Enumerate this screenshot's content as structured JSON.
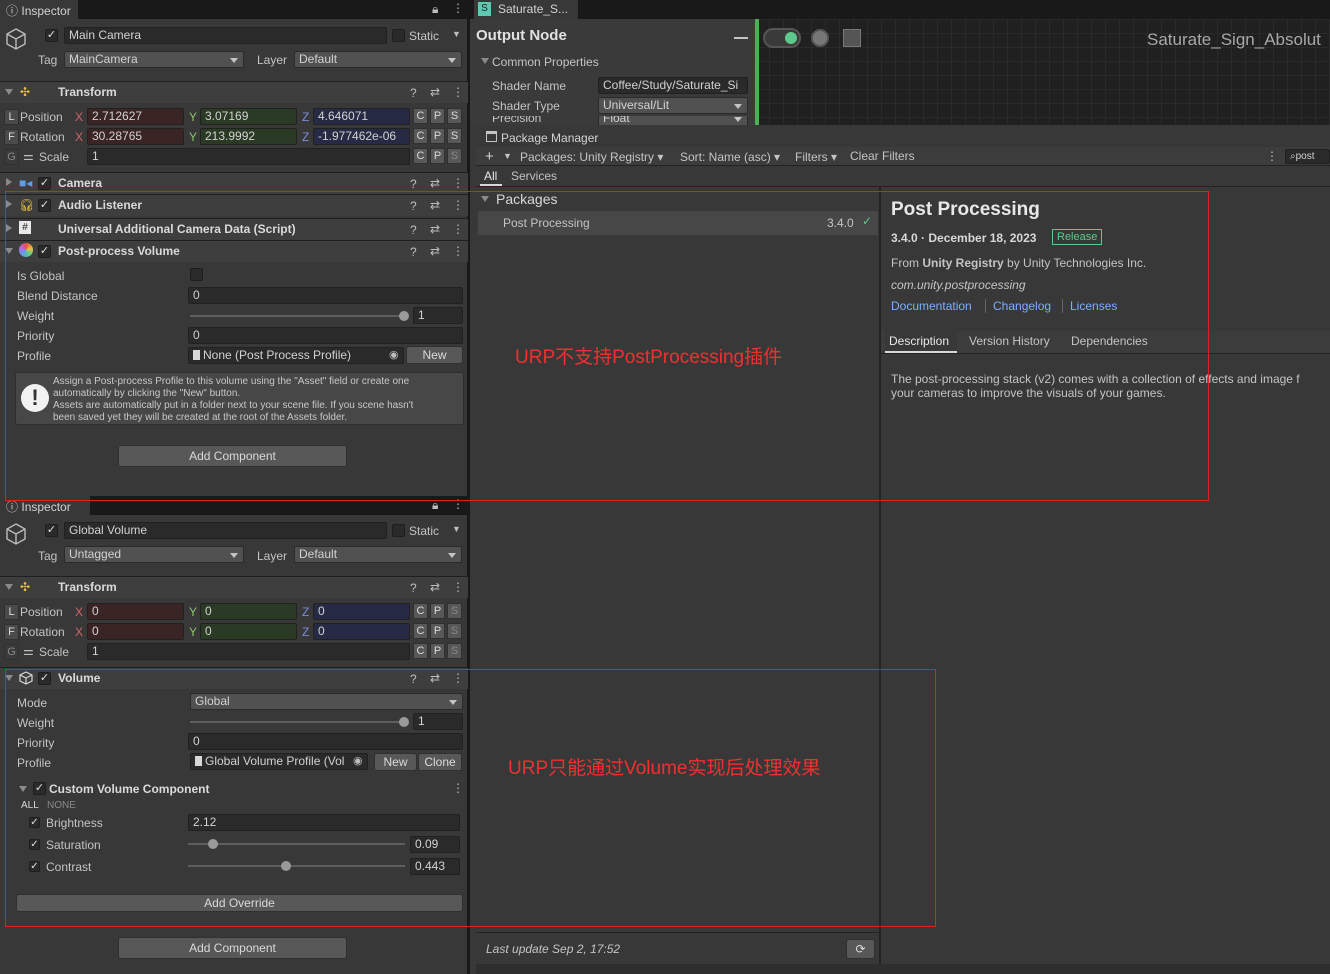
{
  "inspector_top": {
    "tab": "Inspector",
    "object_name": "Main Camera",
    "static_label": "Static",
    "tag_label": "Tag",
    "tag_value": "MainCamera",
    "layer_label": "Layer",
    "layer_value": "Default"
  },
  "transform_top": {
    "title": "Transform",
    "pos_label": "Position",
    "rot_label": "Rotation",
    "scale_label": "Scale",
    "pos": {
      "x": "2.712627",
      "y": "3.07169",
      "z": "4.646071"
    },
    "rot": {
      "x": "30.28765",
      "y": "213.9992",
      "z": "-1.977462e-06"
    },
    "scale": "1",
    "L": "L",
    "F": "F",
    "G": "G"
  },
  "axes": {
    "x": "X",
    "y": "Y",
    "z": "Z",
    "c": "C",
    "p": "P",
    "s": "S"
  },
  "components_top": [
    "Camera",
    "Audio Listener",
    "Universal Additional Camera Data (Script)",
    "Post-process Volume"
  ],
  "ppv": {
    "is_global": "Is Global",
    "blend": "Blend Distance",
    "blend_val": "0",
    "weight": "Weight",
    "weight_val": "1",
    "priority": "Priority",
    "priority_val": "0",
    "profile": "Profile",
    "profile_val": "None (Post Process Profile)",
    "new": "New",
    "help1": "Assign a Post-process Profile to this volume using the \"Asset\" field or create one",
    "help2": "automatically by clicking the \"New\" button.",
    "help3": "Assets are automatically put in a folder next to your scene file. If you scene hasn't",
    "help4": "been saved yet they will be created at the root of the Assets folder.",
    "add_component": "Add Component"
  },
  "inspector_bottom": {
    "tab": "Inspector",
    "object_name": "Global Volume",
    "static_label": "Static",
    "tag_label": "Tag",
    "tag_value": "Untagged",
    "layer_label": "Layer",
    "layer_value": "Default"
  },
  "transform_bottom": {
    "title": "Transform",
    "pos_label": "Position",
    "rot_label": "Rotation",
    "scale_label": "Scale",
    "pos": {
      "x": "0",
      "y": "0",
      "z": "0"
    },
    "rot": {
      "x": "0",
      "y": "0",
      "z": "0"
    },
    "scale": "1"
  },
  "volume": {
    "title": "Volume",
    "mode": "Mode",
    "mode_val": "Global",
    "weight": "Weight",
    "weight_val": "1",
    "priority": "Priority",
    "priority_val": "0",
    "profile": "Profile",
    "profile_val": "Global Volume Profile (Vol",
    "new": "New",
    "clone": "Clone",
    "custom": "Custom Volume Component",
    "all": "ALL",
    "none": "NONE",
    "brightness": "Brightness",
    "brightness_val": "2.12",
    "saturation": "Saturation",
    "saturation_val": "0.09",
    "contrast": "Contrast",
    "contrast_val": "0.443",
    "add_override": "Add Override",
    "add_component": "Add Component"
  },
  "shader": {
    "tab": "Saturate_S...",
    "title": "Output Node",
    "common": "Common Properties",
    "shader_name": "Shader Name",
    "shader_name_val": "Coffee/Study/Saturate_Si",
    "shader_type": "Shader Type",
    "shader_type_val": "Universal/Lit",
    "precision": "Precision",
    "precision_val": "Float",
    "graph_title": "Saturate_Sign_Absolut"
  },
  "pm": {
    "title": "Package Manager",
    "packages_dd": "Packages: Unity Registry",
    "sort_dd": "Sort: Name (asc)",
    "filters": "Filters",
    "clear": "Clear Filters",
    "search": "post",
    "tab_all": "All",
    "tab_services": "Services",
    "packages_hdr": "Packages",
    "pkg_name": "Post Processing",
    "pkg_ver": "3.4.0",
    "d_title": "Post Processing",
    "d_ver": "3.4.0 · December 18, 2023",
    "release": "Release",
    "from": "From ",
    "registry": "Unity Registry",
    "by": " by Unity Technologies Inc.",
    "pkgid": "com.unity.postprocessing",
    "doc": "Documentation",
    "changelog": "Changelog",
    "licenses": "Licenses",
    "t_desc": "Description",
    "t_hist": "Version History",
    "t_dep": "Dependencies",
    "desc1": "The post-processing stack (v2) comes with a collection of effects and image f",
    "desc2": "your cameras to improve the visuals of your games.",
    "last_update": "Last update Sep 2, 17:52"
  },
  "annotations": {
    "a1": "URP不支持PostProcessing插件",
    "a2": "URP只能通过Volume实现后处理效果"
  },
  "colors": {
    "annotation": "#e02020",
    "link": "#7bafff",
    "release": "#5ec98c"
  }
}
